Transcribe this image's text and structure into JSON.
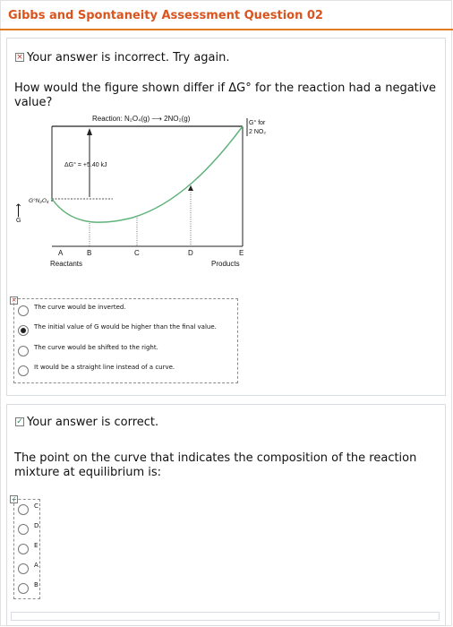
{
  "page_title": "Gibbs and Spontaneity Assessment Question 02",
  "q1": {
    "status": "Your answer is incorrect.  Try again.",
    "status_mark": "×",
    "question_line1": "How would the figure shown differ if ΔG° for the reaction had a negative",
    "question_line2": "value?",
    "figure": {
      "reaction": "Reaction: N₂O₄(g) ⟶ 2NO₂(g)",
      "g_label": "G",
      "g_arrow": "⟵",
      "dg_label": "ΔG° = +5.40 kJ",
      "g_n2o4": "G°N₂O₄",
      "g_for_1": "G° for",
      "g_for_2": "2 NO₂",
      "points": [
        "A",
        "B",
        "C",
        "D",
        "E"
      ],
      "reactants": "Reactants",
      "products": "Products"
    },
    "options_mark": "×",
    "options": [
      {
        "label": "The curve would be inverted.",
        "selected": false
      },
      {
        "label": "The initial value of G would be higher than the final value.",
        "selected": true
      },
      {
        "label": "The curve would be shifted to the right.",
        "selected": false
      },
      {
        "label": "It would be a straight line instead of a curve.",
        "selected": false
      }
    ]
  },
  "q2": {
    "status": "Your answer is correct.",
    "status_mark": "✓",
    "question_line1": "The point on the curve that indicates the composition of the reaction",
    "question_line2": "mixture at equilibrium is:",
    "options_mark": "✓",
    "options": [
      {
        "label": "C",
        "selected": false
      },
      {
        "label": "D",
        "selected": false
      },
      {
        "label": "E",
        "selected": false
      },
      {
        "label": "A",
        "selected": false
      },
      {
        "label": "B",
        "selected": false
      }
    ]
  },
  "colors": {
    "title": "#d9541e",
    "title_rule": "#e07b1f",
    "curve": "#5fb27a"
  }
}
